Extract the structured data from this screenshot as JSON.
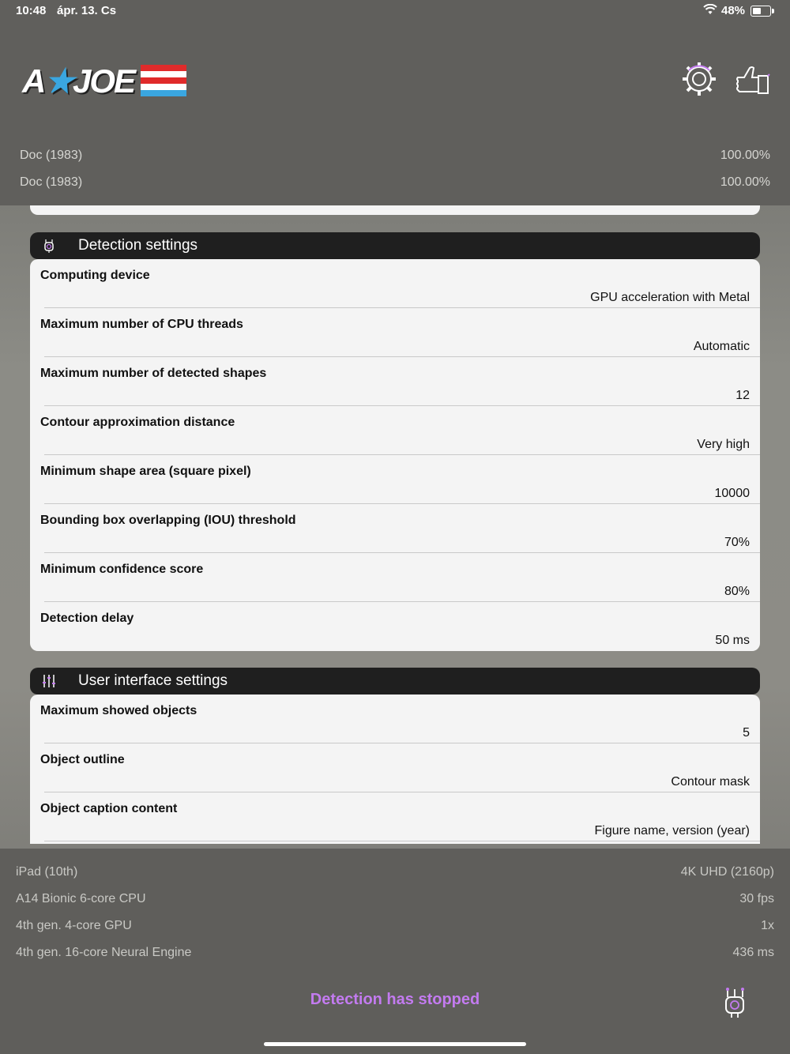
{
  "status_bar": {
    "time": "10:48",
    "date": "ápr. 13. Cs",
    "battery": "48%"
  },
  "logo_text": "GI JOE",
  "detections": [
    {
      "name": "Doc (1983)",
      "value": "100.00%"
    },
    {
      "name": "Doc (1983)",
      "value": "100.00%"
    }
  ],
  "detection_settings": {
    "title": "Detection settings",
    "items": [
      {
        "label": "Computing device",
        "value": "GPU acceleration with Metal"
      },
      {
        "label": "Maximum number of CPU threads",
        "value": "Automatic"
      },
      {
        "label": "Maximum number of detected shapes",
        "value": "12"
      },
      {
        "label": "Contour approximation distance",
        "value": "Very high"
      },
      {
        "label": "Minimum shape area (square pixel)",
        "value": "10000"
      },
      {
        "label": "Bounding box overlapping (IOU) threshold",
        "value": "70%"
      },
      {
        "label": "Minimum confidence score",
        "value": "80%"
      },
      {
        "label": "Detection delay",
        "value": "50 ms"
      }
    ]
  },
  "ui_settings": {
    "title": "User interface settings",
    "items": [
      {
        "label": "Maximum showed objects",
        "value": "5"
      },
      {
        "label": "Object outline",
        "value": "Contour mask"
      },
      {
        "label": "Object caption content",
        "value": "Figure name, version (year)"
      }
    ]
  },
  "device_info": [
    {
      "left": "iPad (10th)",
      "right": "4K UHD (2160p)"
    },
    {
      "left": "A14 Bionic 6-core CPU",
      "right": "30 fps"
    },
    {
      "left": "4th gen. 4-core GPU",
      "right": "1x"
    },
    {
      "left": "4th gen. 16-core Neural Engine",
      "right": "436 ms"
    }
  ],
  "status_message": "Detection has stopped",
  "colors": {
    "accent": "#c37bf0",
    "header_bg": "#1f1f1f",
    "card_bg": "#f4f4f4"
  },
  "icons": [
    "wifi-icon",
    "battery-icon",
    "gear-icon",
    "thumbs-up-icon",
    "chip-icon",
    "sliders-icon",
    "neural-chip-icon"
  ]
}
